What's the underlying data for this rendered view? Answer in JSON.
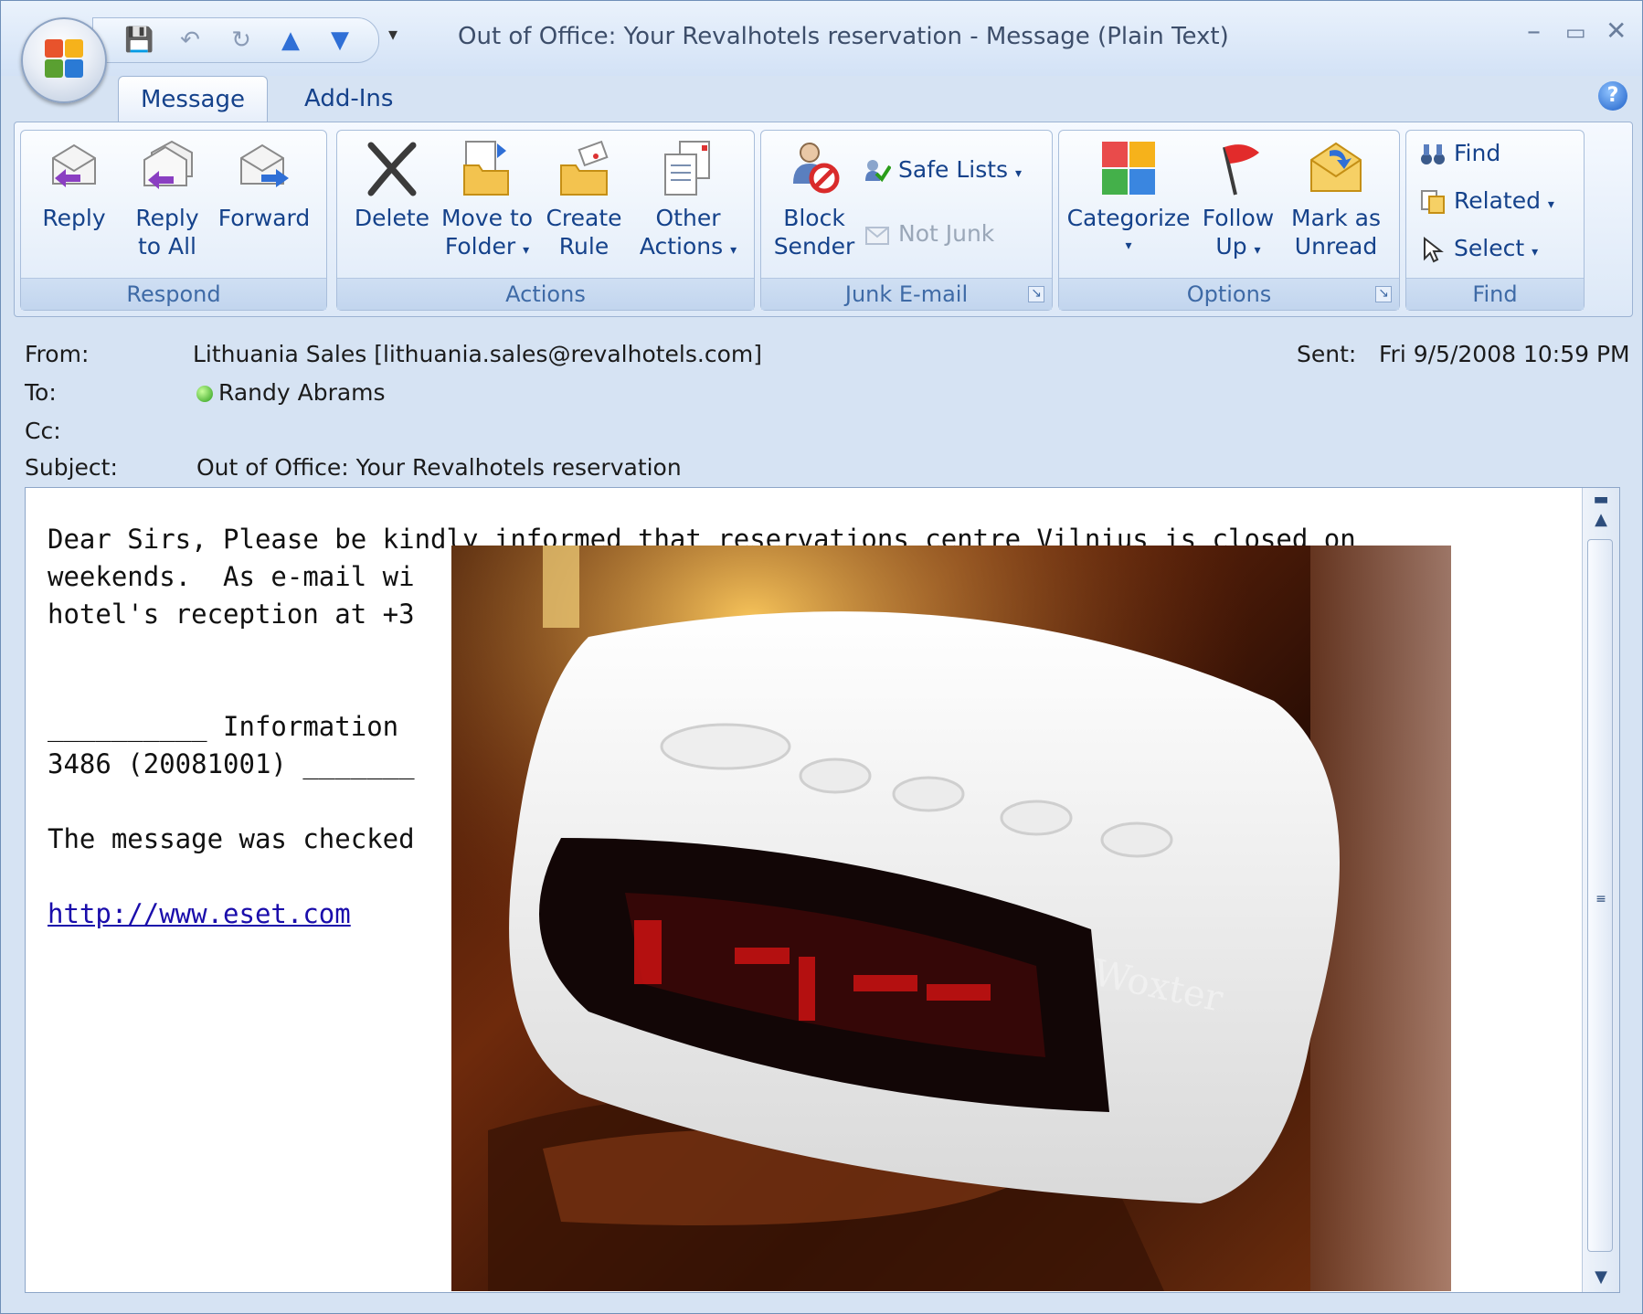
{
  "window": {
    "title": "Out of Office: Your Revalhotels reservation - Message (Plain Text)"
  },
  "tabs": [
    {
      "label": "Message",
      "active": true
    },
    {
      "label": "Add-Ins",
      "active": false
    }
  ],
  "ribbon": {
    "respond": {
      "label": "Respond",
      "reply": "Reply",
      "reply_all_1": "Reply",
      "reply_all_2": "to All",
      "forward": "Forward"
    },
    "actions": {
      "label": "Actions",
      "delete": "Delete",
      "move_1": "Move to",
      "move_2": "Folder",
      "create_1": "Create",
      "create_2": "Rule",
      "other_1": "Other",
      "other_2": "Actions"
    },
    "junk": {
      "label": "Junk E-mail",
      "block_1": "Block",
      "block_2": "Sender",
      "safe_lists": "Safe Lists",
      "not_junk": "Not Junk"
    },
    "options": {
      "label": "Options",
      "categorize": "Categorize",
      "follow_1": "Follow",
      "follow_2": "Up",
      "mark_1": "Mark as",
      "mark_2": "Unread"
    },
    "find": {
      "label": "Find",
      "find": "Find",
      "related": "Related",
      "select": "Select"
    }
  },
  "header": {
    "from_label": "From:",
    "from_value": "Lithuania Sales [lithuania.sales@revalhotels.com]",
    "sent_label": "Sent:",
    "sent_value": "Fri 9/5/2008 10:59 PM",
    "to_label": "To:",
    "to_value": "Randy Abrams",
    "cc_label": "Cc:",
    "subject_label": "Subject:",
    "subject_value": "Out of Office: Your Revalhotels reservation"
  },
  "body": {
    "line1": "Dear Sirs, Please be kindly informed that reservations centre Vilnius is closed on",
    "line2": "weekends.  As e-mail wi                                                   ontact",
    "line3": "hotel's reception at +3",
    "line5": "__________ Information                                                    base",
    "line6": "3486 (20081001) _______",
    "line8": "The message was checked",
    "link": "http://www.eset.com"
  },
  "photo": {
    "brand": "Woxter"
  },
  "colors": {
    "ribbon_text": "#15428b",
    "group_label": "#3e6aa6",
    "link": "#1a0dab"
  }
}
